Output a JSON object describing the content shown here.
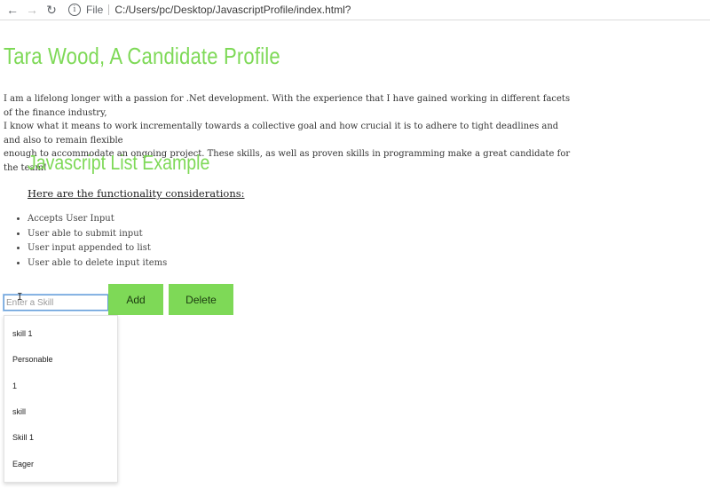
{
  "browser": {
    "back_icon": "←",
    "forward_icon": "→",
    "reload_icon": "↻",
    "info_icon": "i",
    "scheme": "File",
    "url": "C:/Users/pc/Desktop/JavascriptProfile/index.html?"
  },
  "page": {
    "title": "Tara Wood, A Candidate Profile",
    "intro_lines": [
      "I am a lifelong longer with a passion for .Net development. With the experience that I have gained working in different facets of the finance industry,",
      "I know what it means to work incrementally towards a collective goal and how crucial it is to adhere to tight deadlines and and also to remain flexible",
      "enough to accommodate an ongoing project. These skills, as well as proven skills in programming make a great candidate for the team!"
    ],
    "section_title": "Javascript List Example",
    "considerations_heading": "Here are the functionality considerations:",
    "features": [
      "Accepts User Input",
      "User able to submit input",
      "User input appended to list",
      "User able to delete input items"
    ]
  },
  "form": {
    "input_value": "",
    "input_placeholder": "Enter a Skill",
    "cursor_glyph": "I",
    "add_label": "Add",
    "delete_label": "Delete"
  },
  "suggestions": [
    "skill 1",
    "Personable",
    "1",
    "skill",
    "Skill 1",
    "Eager"
  ],
  "colors": {
    "accent": "#7ed957",
    "input_focus": "#6aa0d8"
  }
}
